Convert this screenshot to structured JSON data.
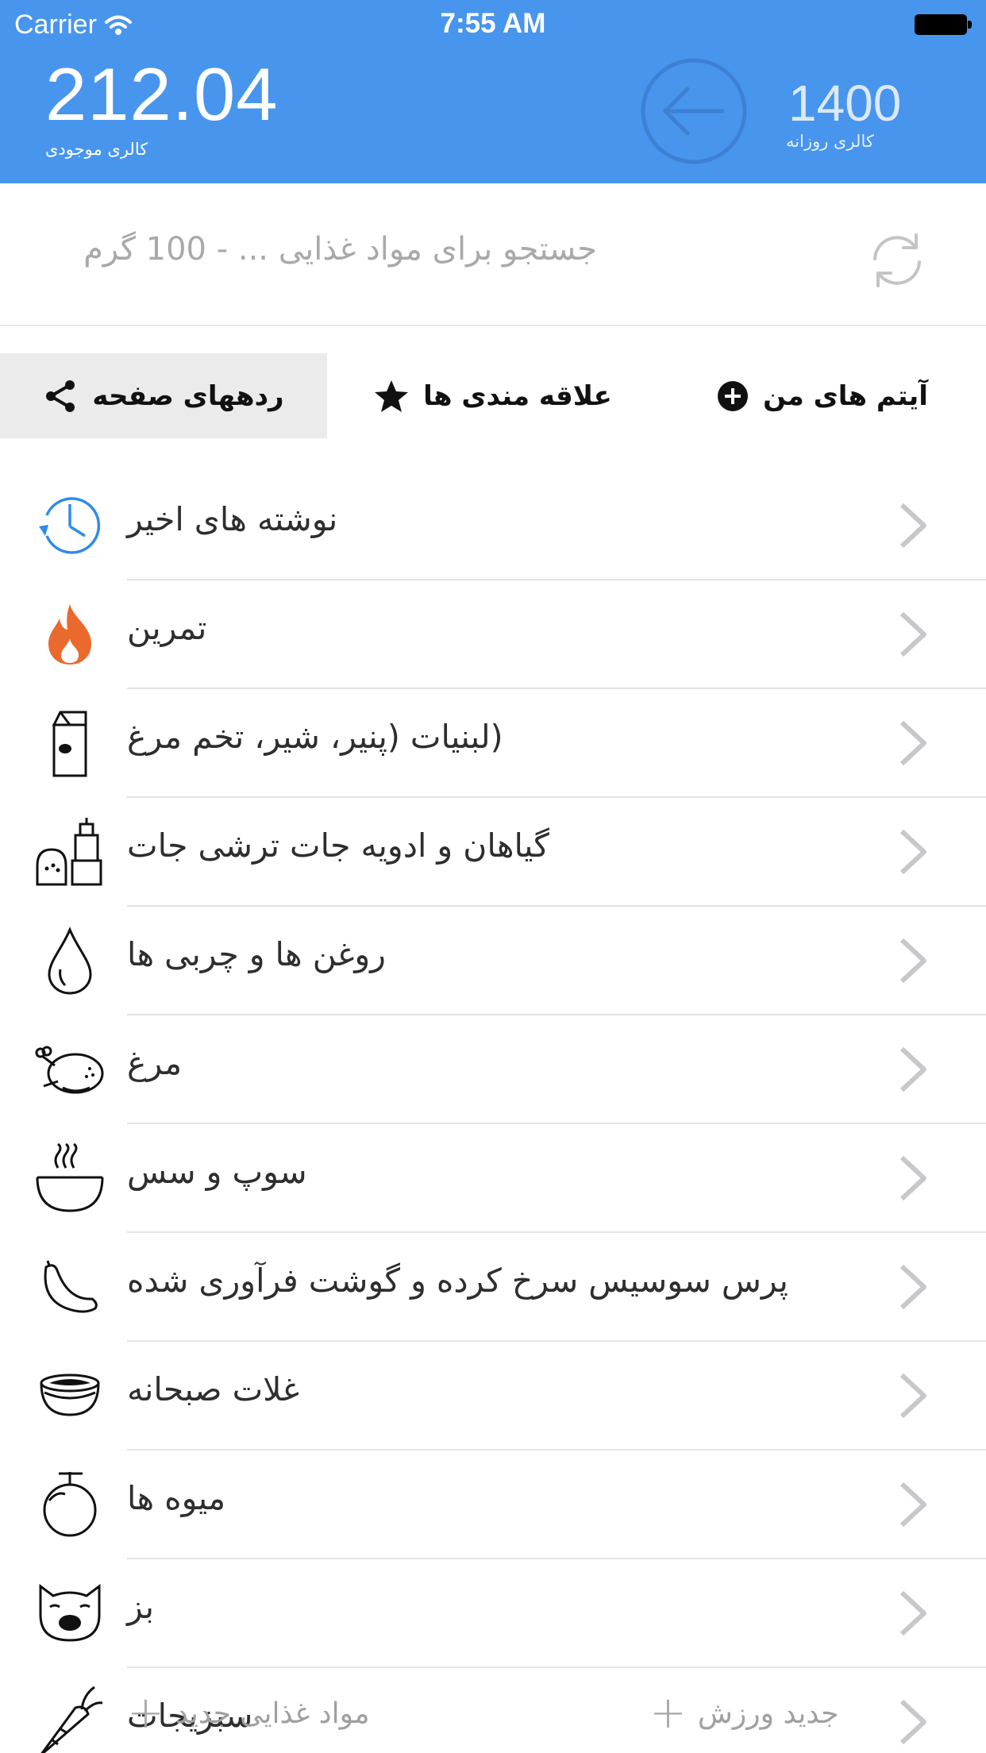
{
  "status_bar": {
    "carrier": "Carrier",
    "time": "7:55 AM"
  },
  "header": {
    "available_calories": "212.04",
    "available_label": "کالری موجودی",
    "daily_calories": "1400",
    "daily_label": "کالری روزانه"
  },
  "search": {
    "placeholder": "جستجو برای مواد غذایی ... - 100 گرم"
  },
  "tabs": [
    {
      "label": "ردههای صفحه",
      "icon": "share-icon",
      "active": true
    },
    {
      "label": "علاقه مندی ها",
      "icon": "star-icon",
      "active": false
    },
    {
      "label": "آیتم های من",
      "icon": "plus-circle-icon",
      "active": false
    }
  ],
  "categories": [
    {
      "label": "نوشته های اخیر",
      "icon": "clock-icon"
    },
    {
      "label": "تمرین",
      "icon": "flame-icon"
    },
    {
      "label": "(لبنیات (پنیر، شیر، تخم مرغ",
      "icon": "milk-carton-icon"
    },
    {
      "label": "گیاهان و ادویه جات ترشی جات",
      "icon": "spice-shaker-icon"
    },
    {
      "label": "روغن ها و چربی ها",
      "icon": "oil-drop-icon"
    },
    {
      "label": "مرغ",
      "icon": "chicken-icon"
    },
    {
      "label": "سوپ و سس",
      "icon": "soup-bowl-icon"
    },
    {
      "label": "پرس سوسیس سرخ کرده و گوشت فرآوری شده",
      "icon": "sausage-icon"
    },
    {
      "label": "غلات صبحانه",
      "icon": "cereal-bowl-icon"
    },
    {
      "label": "میوه ها",
      "icon": "fruit-icon"
    },
    {
      "label": "بز",
      "icon": "goat-icon"
    },
    {
      "label": "سبزیجات",
      "icon": "carrot-icon"
    }
  ],
  "footer": {
    "new_food_label": "مواد غذایی جدید",
    "new_exercise_label": "جدید ورزش"
  },
  "colors": {
    "header_bg": "#4895ee",
    "accent_orange": "#ea6a2e",
    "accent_blue": "#2f8bea"
  }
}
